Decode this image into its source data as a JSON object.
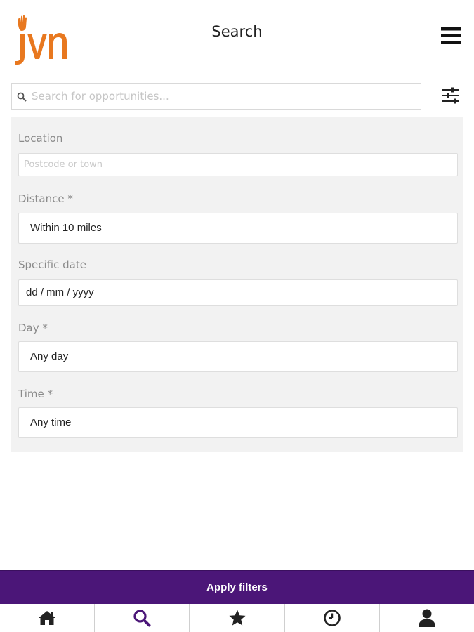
{
  "header": {
    "title": "Search",
    "logo_text": "jvn",
    "logo_icon": "jvn-logo-icon",
    "menu_icon": "hamburger-menu-icon"
  },
  "search": {
    "placeholder": "Search for opportunities...",
    "value": "",
    "icon": "search-icon",
    "filter_icon": "sliders-icon"
  },
  "filters": {
    "location": {
      "label": "Location",
      "placeholder": "Postcode or town",
      "value": ""
    },
    "distance": {
      "label": "Distance *",
      "value": "Within 10 miles"
    },
    "specific_date": {
      "label": "Specific date",
      "value": "dd / mm / yyyy"
    },
    "day": {
      "label": "Day *",
      "value": "Any day"
    },
    "time": {
      "label": "Time *",
      "value": "Any time"
    }
  },
  "apply_button": {
    "label": "Apply filters"
  },
  "bottom_nav": [
    {
      "icon": "home-icon",
      "active": false
    },
    {
      "icon": "search-icon",
      "active": true
    },
    {
      "icon": "star-icon",
      "active": false
    },
    {
      "icon": "clock-icon",
      "active": false
    },
    {
      "icon": "user-icon",
      "active": false
    }
  ],
  "colors": {
    "brand_orange": "#e8781f",
    "accent_purple": "#4b1678",
    "active_nav": "#4b1678",
    "panel_bg": "#f2f2f2"
  }
}
